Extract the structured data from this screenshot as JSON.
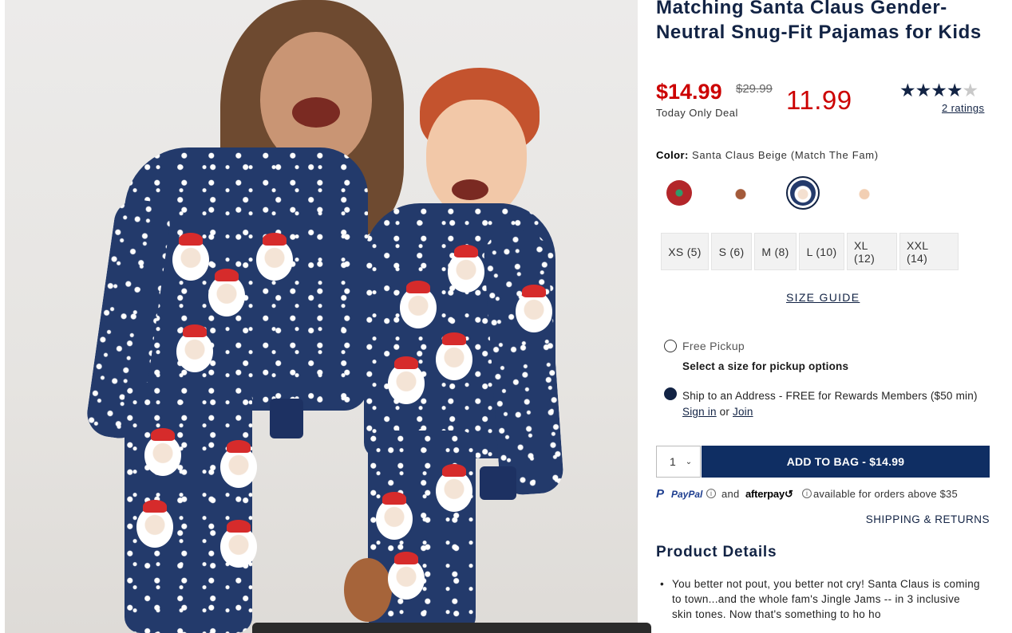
{
  "product": {
    "title": "Matching Santa Claus Gender-Neutral Snug-Fit Pajamas for Kids",
    "price_sale": "$14.99",
    "price_original": "$29.99",
    "price_alt": "11.99",
    "deal_label": "Today Only Deal",
    "rating": {
      "value": 4,
      "max": 5,
      "link_text": "2 ratings"
    }
  },
  "colors": {
    "label": "Color:",
    "selected": "Santa Claus Beige (Match The Fam)",
    "swatches": [
      {
        "name": "red-print-swatch",
        "selected": false
      },
      {
        "name": "santa-light-swatch",
        "selected": false
      },
      {
        "name": "santa-beige-swatch",
        "selected": true
      },
      {
        "name": "santa-cream-swatch",
        "selected": false
      }
    ]
  },
  "sizes": [
    "XS (5)",
    "S (6)",
    "M (8)",
    "L (10)",
    "XL (12)",
    "XXL (14)"
  ],
  "size_guide": "SIZE GUIDE",
  "fulfillment": {
    "pickup_label": "Free Pickup",
    "pickup_note": "Select a size for pickup options",
    "ship_label": "Ship to an Address - FREE for Rewards Members ($50 min)",
    "sign_in": "Sign in",
    "or": "or",
    "join": "Join",
    "selected": "ship"
  },
  "cart": {
    "quantity": "1",
    "add_to_bag": "ADD TO BAG  -  $14.99"
  },
  "payments": {
    "paypal": "PayPal",
    "and": "and",
    "afterpay": "afterpay",
    "afterpay_note": "available for orders above $35"
  },
  "shipping_returns": "SHIPPING & RETURNS",
  "details": {
    "heading": "Product Details",
    "bullets": [
      "You better not pout, you better not cry! Santa Claus is coming to town...and the whole fam's Jingle Jams -- in 3 inclusive skin tones. Now that's something to ho ho"
    ]
  }
}
